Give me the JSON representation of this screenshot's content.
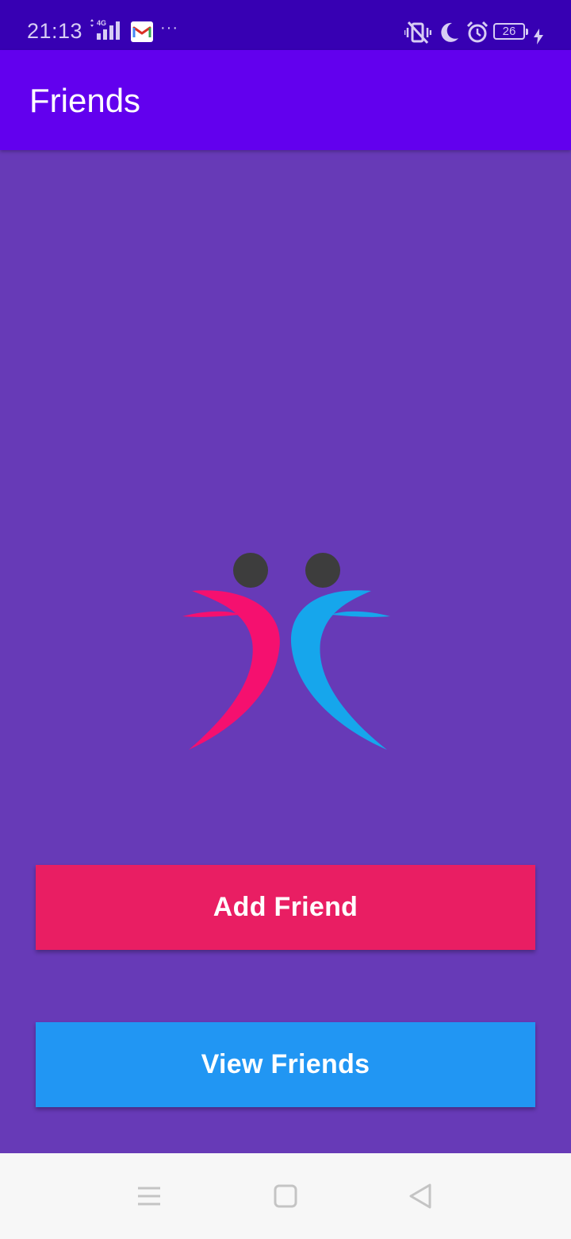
{
  "status_bar": {
    "time": "21:13",
    "network": "4G",
    "battery_level": "26",
    "icons": [
      "signal-icon",
      "gmail-icon",
      "more-icon",
      "vibrate-icon",
      "do-not-disturb-icon",
      "alarm-icon",
      "battery-icon",
      "charging-icon"
    ]
  },
  "app_bar": {
    "title": "Friends",
    "color": "#6200ee"
  },
  "logo": {
    "icon": "friends-logo-icon",
    "colors": {
      "left": "#f5106f",
      "right": "#16a6ec",
      "heads": "#3d3d3d"
    }
  },
  "actions": {
    "add_label": "Add Friend",
    "add_color": "#e91e63",
    "view_label": "View Friends",
    "view_color": "#2196f3"
  },
  "nav_bar": {
    "icons": [
      "menu-icon",
      "home-icon",
      "back-icon"
    ]
  },
  "colors": {
    "status_bar": "#3700b3",
    "background": "#673ab7"
  }
}
